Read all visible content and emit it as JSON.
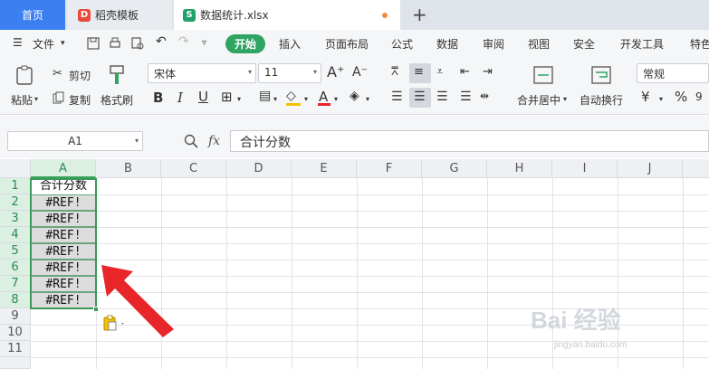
{
  "tabs": [
    {
      "label": "首页"
    },
    {
      "label": "稻壳模板"
    },
    {
      "label": "数据统计.xlsx"
    }
  ],
  "menu": {
    "file_label": "文件",
    "items": [
      "开始",
      "插入",
      "页面布局",
      "公式",
      "数据",
      "审阅",
      "视图",
      "安全",
      "开发工具",
      "特色"
    ]
  },
  "ribbon": {
    "paste": "粘贴",
    "cut": "剪切",
    "copy": "复制",
    "format_painter": "格式刷",
    "font_name": "宋体",
    "font_size": "11",
    "merge_center": "合并居中",
    "wrap_text": "自动换行",
    "number_format": "常规"
  },
  "formula_bar": {
    "name_box": "A1",
    "fx": "fx",
    "content": "合计分数"
  },
  "sheet": {
    "columns": [
      "A",
      "B",
      "C",
      "D",
      "E",
      "F",
      "G",
      "H",
      "I",
      "J"
    ],
    "rows": [
      "1",
      "2",
      "3",
      "4",
      "5",
      "6",
      "7",
      "8",
      "9",
      "10",
      "11"
    ],
    "cells": [
      "合计分数",
      "#REF!",
      "#REF!",
      "#REF!",
      "#REF!",
      "#REF!",
      "#REF!",
      "#REF!"
    ],
    "selected_column": "A"
  },
  "watermark": {
    "logo": "Bai 经验",
    "url": "jingyan.baidu.com"
  },
  "colors": {
    "accent_green": "#2fa463",
    "tab_home_blue": "#3c7ff0",
    "arrow_red": "#e8262a"
  }
}
